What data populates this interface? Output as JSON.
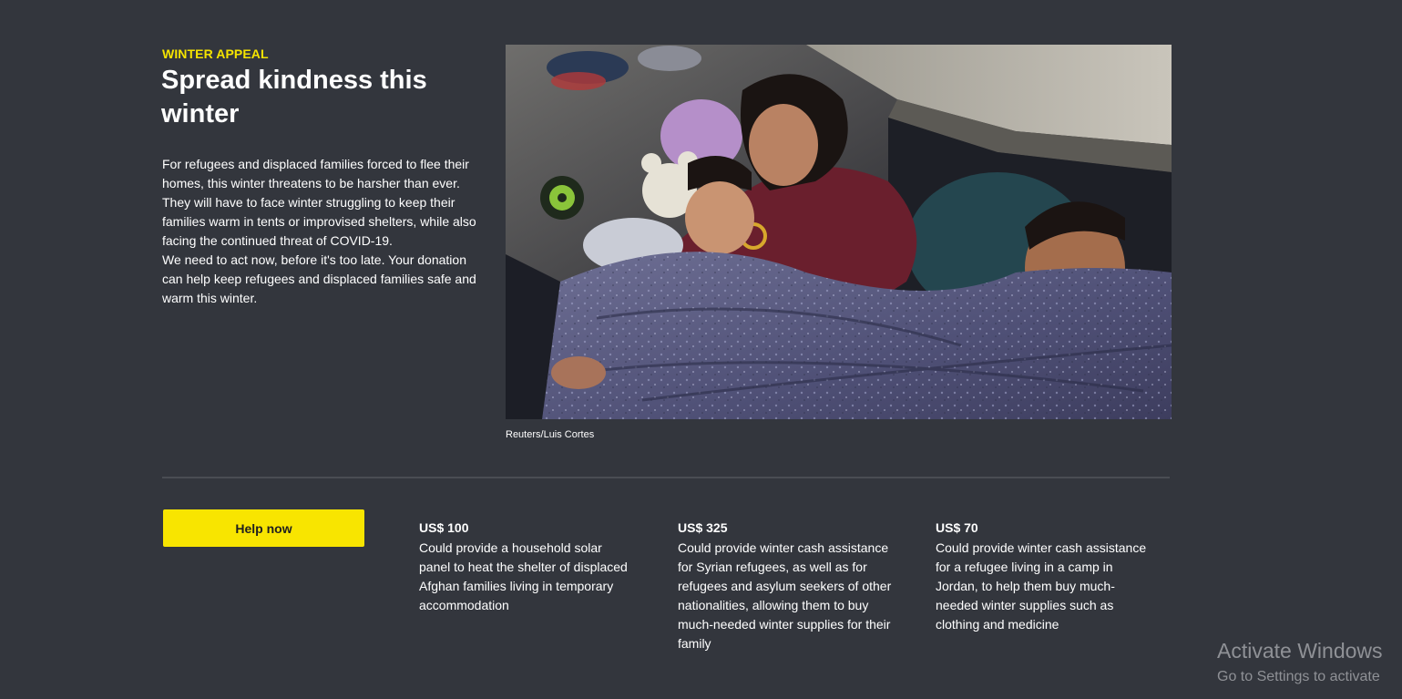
{
  "intro": {
    "eyebrow": "WINTER APPEAL",
    "headline": "Spread kindness this winter",
    "paragraphs": [
      "For refugees and displaced families forced to flee their homes, this winter threatens to be harsher than ever.",
      "They will have to face winter struggling to keep their families warm in tents or improvised shelters, while also facing the continued threat of COVID-19.",
      "We need to act now, before it's too late. Your donation can help keep refugees and displaced families safe and warm this winter."
    ]
  },
  "photo": {
    "caption": "Reuters/Luis Cortes",
    "alt": "Family sleeping under a blanket"
  },
  "cta": {
    "help_label": "Help now"
  },
  "tiers": [
    {
      "amount": "US$ 100",
      "description": "Could provide a household solar panel to heat the shelter of displaced Afghan families living in temporary accommodation"
    },
    {
      "amount": "US$ 325",
      "description": "Could provide winter cash assistance for Syrian refugees, as well as for refugees and asylum seekers of other nationalities, allowing them to buy much-needed winter supplies for their family"
    },
    {
      "amount": "US$ 70",
      "description": "Could provide winter cash assistance for a refugee living in a camp in Jordan, to help them buy much-needed winter supplies such as clothing and medicine"
    }
  ],
  "os_watermark": {
    "line1": "Activate Windows",
    "line2": "Go to Settings to activate"
  },
  "colors": {
    "background": "#33363d",
    "accent": "#f5e400",
    "button": "#f8e500"
  }
}
